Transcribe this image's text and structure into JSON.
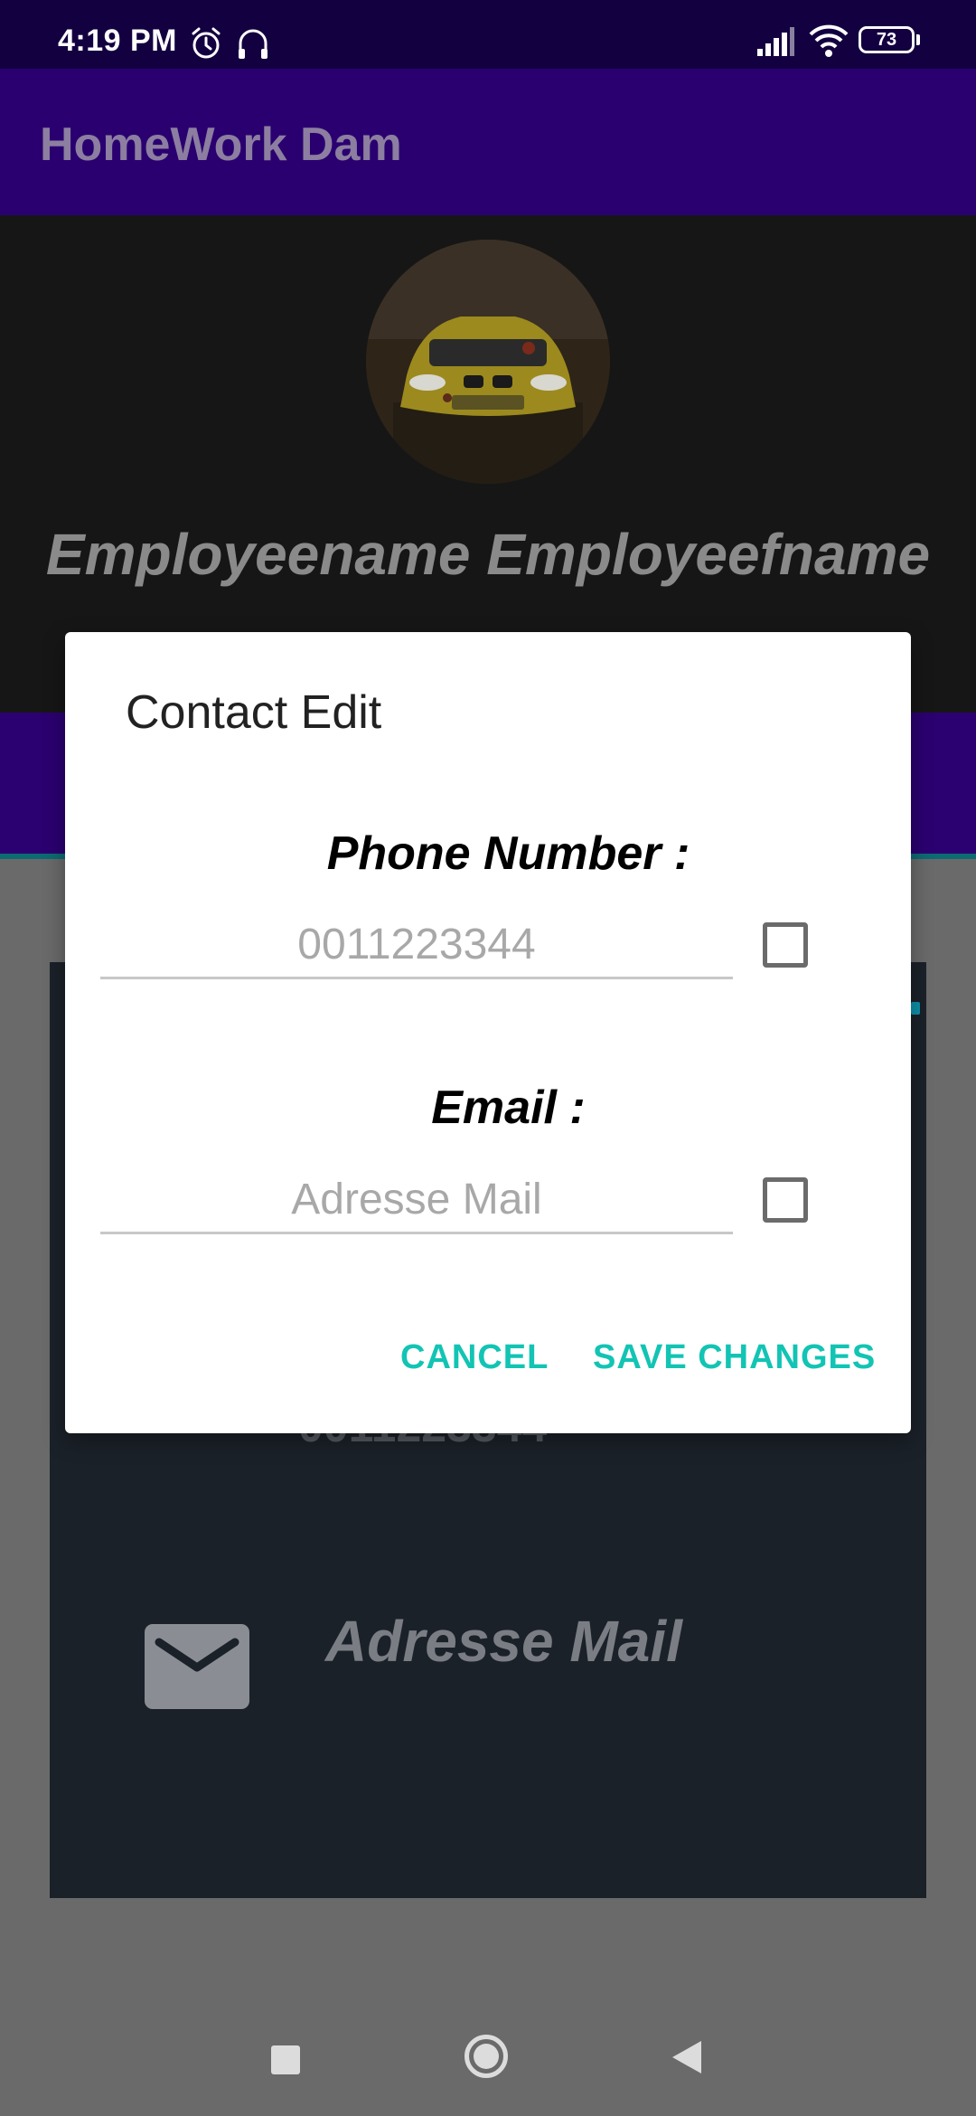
{
  "status_bar": {
    "time": "4:19 PM",
    "battery": "73",
    "icons": [
      "alarm-icon",
      "headset-icon",
      "signal-icon",
      "wifi-icon",
      "battery-icon"
    ]
  },
  "app_bar": {
    "title": "HomeWork Dam"
  },
  "profile": {
    "name": "Employeename Employeefname"
  },
  "contact_card": {
    "phone_value": "0011223344",
    "email_value": "Adresse Mail",
    "icons": [
      "mail-icon"
    ]
  },
  "dialog": {
    "title": "Contact Edit",
    "phone_label": "Phone Number :",
    "phone_placeholder": "0011223344",
    "phone_checked": false,
    "email_label": "Email :",
    "email_placeholder": "Adresse Mail",
    "email_checked": false,
    "cancel_label": "CANCEL",
    "save_label": "SAVE CHANGES"
  },
  "colors": {
    "accent": "#12c4b4",
    "primary": "#2a0070",
    "status_bar": "#130040"
  },
  "nav_bar": {
    "icons": [
      "recents-icon",
      "home-icon",
      "back-icon"
    ]
  }
}
